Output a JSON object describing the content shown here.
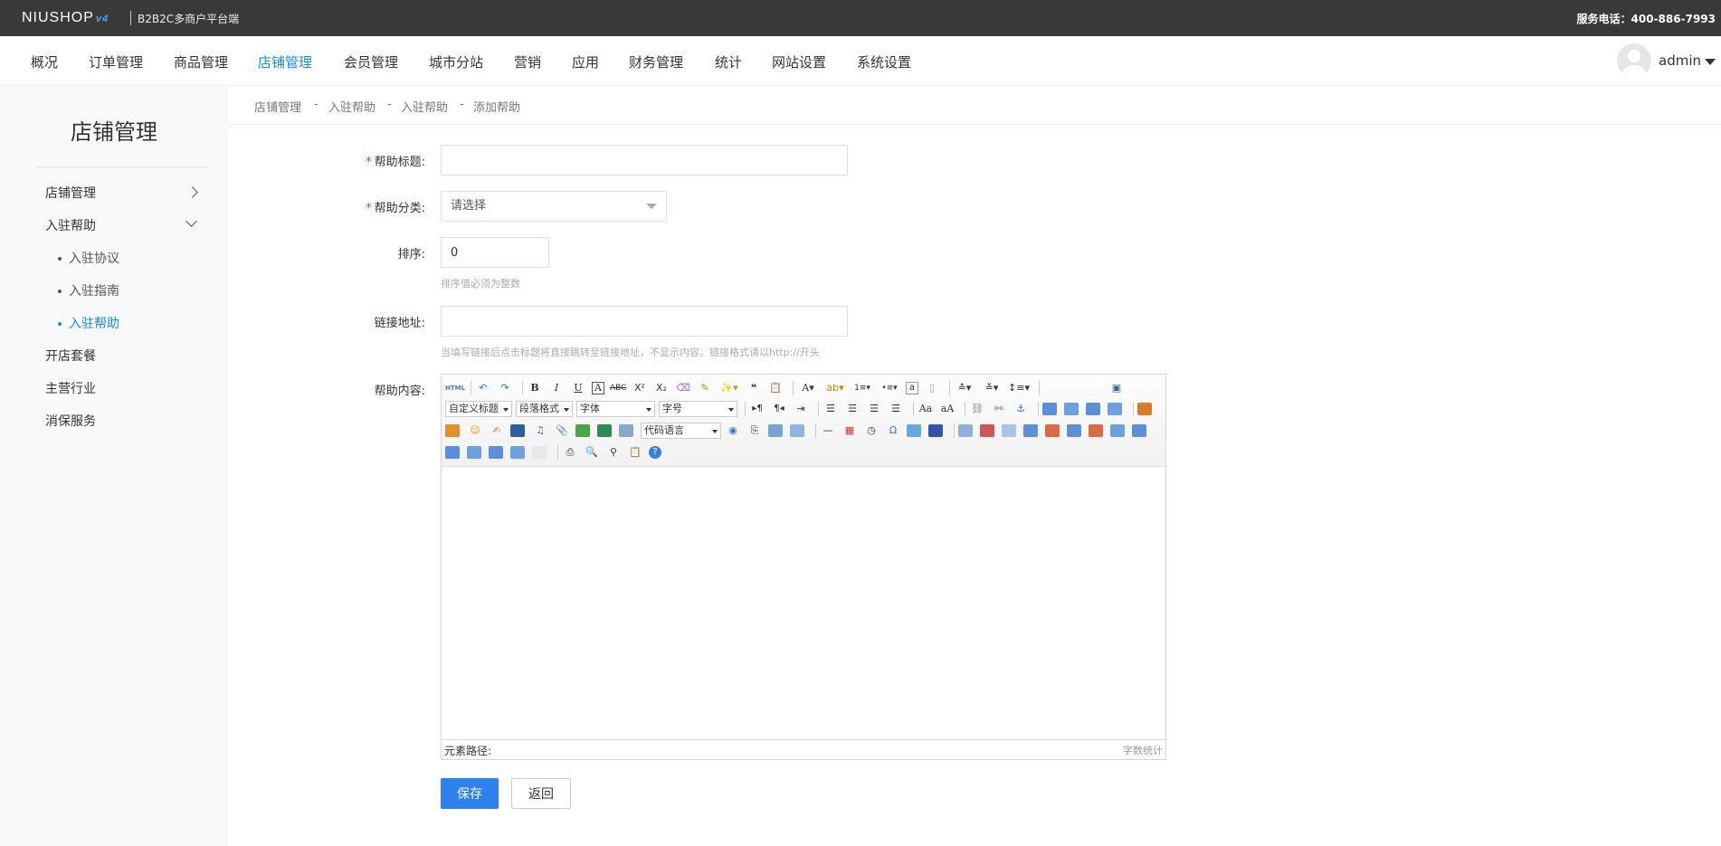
{
  "topbar": {
    "logo_text": "NIUSHOP",
    "logo_version": "v4",
    "platform_label": "B2B2C多商户平台端",
    "service_phone": "服务电话：400-886-7993"
  },
  "nav": {
    "items": [
      "概况",
      "订单管理",
      "商品管理",
      "店铺管理",
      "会员管理",
      "城市分站",
      "营销",
      "应用",
      "财务管理",
      "统计",
      "网站设置",
      "系统设置"
    ],
    "active": "店铺管理",
    "user_name": "admin"
  },
  "sidebar": {
    "title": "店铺管理",
    "items": [
      {
        "label": "店铺管理"
      },
      {
        "label": "入驻帮助"
      },
      {
        "label": "开店套餐"
      },
      {
        "label": "主营行业"
      },
      {
        "label": "消保服务"
      }
    ],
    "subitems": [
      {
        "label": "入驻协议"
      },
      {
        "label": "入驻指南"
      },
      {
        "label": "入驻帮助"
      }
    ]
  },
  "breadcrumb": {
    "items": [
      "店铺管理",
      "入驻帮助",
      "入驻帮助",
      "添加帮助"
    ],
    "separator": "-"
  },
  "form": {
    "title_label": "帮助标题:",
    "title_value": "",
    "category_label": "帮助分类:",
    "category_value": "请选择",
    "sort_label": "排序:",
    "sort_value": "0",
    "sort_help": "排序值必须为整数",
    "link_label": "链接地址:",
    "link_value": "",
    "link_help": "当填写链接后点击标题将直接跳转至链接地址，不显示内容。链接格式请以http://开头",
    "content_label": "帮助内容:",
    "required_mark": "*"
  },
  "editor": {
    "custom_title": "自定义标题",
    "paragraph": "段落格式",
    "font_family": "字体",
    "font_size": "字号",
    "code_lang": "代码语言",
    "path_label": "元素路径:",
    "word_count": "字数统计",
    "html_btn": "HTML"
  },
  "buttons": {
    "save": "保存",
    "back": "返回"
  },
  "colors": {
    "accent": "#1E88E5",
    "topbar": "#393939",
    "sidebar_bg": "#f8f9fb",
    "required": "#ee3333"
  }
}
